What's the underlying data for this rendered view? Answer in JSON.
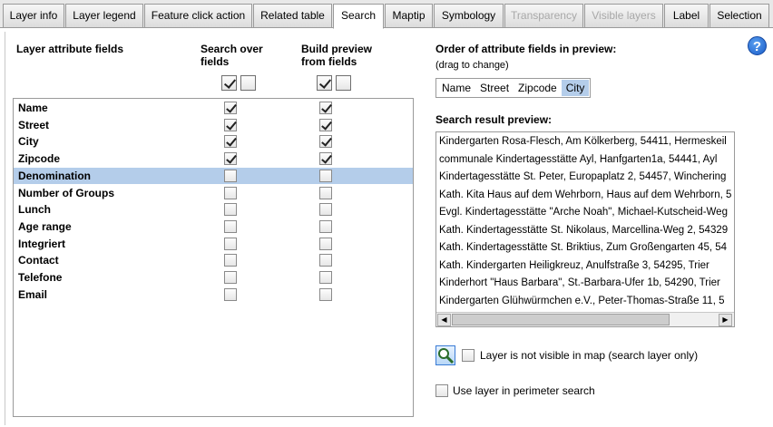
{
  "tabs": [
    {
      "label": "Layer info",
      "state": "normal"
    },
    {
      "label": "Layer legend",
      "state": "normal"
    },
    {
      "label": "Feature click action",
      "state": "normal"
    },
    {
      "label": "Related table",
      "state": "normal"
    },
    {
      "label": "Search",
      "state": "active"
    },
    {
      "label": "Maptip",
      "state": "normal"
    },
    {
      "label": "Symbology",
      "state": "normal"
    },
    {
      "label": "Transparency",
      "state": "disabled"
    },
    {
      "label": "Visible layers",
      "state": "disabled"
    },
    {
      "label": "Label",
      "state": "normal"
    },
    {
      "label": "Selection",
      "state": "normal"
    }
  ],
  "headers": {
    "layer_fields": "Layer attribute fields",
    "search_over_line1": "Search over",
    "search_over_line2": "fields",
    "build_preview_line1": "Build preview",
    "build_preview_line2": "from fields",
    "order_title": "Order of attribute fields in preview:",
    "order_hint": "(drag to change)",
    "preview_title": "Search result preview:"
  },
  "fields": [
    {
      "name": "Name",
      "search": true,
      "preview": true,
      "selected": false
    },
    {
      "name": "Street",
      "search": true,
      "preview": true,
      "selected": false
    },
    {
      "name": "City",
      "search": true,
      "preview": true,
      "selected": false
    },
    {
      "name": "Zipcode",
      "search": true,
      "preview": true,
      "selected": false
    },
    {
      "name": "Denomination",
      "search": false,
      "preview": false,
      "selected": true
    },
    {
      "name": "Number of Groups",
      "search": false,
      "preview": false,
      "selected": false
    },
    {
      "name": "Lunch",
      "search": false,
      "preview": false,
      "selected": false
    },
    {
      "name": "Age range",
      "search": false,
      "preview": false,
      "selected": false
    },
    {
      "name": "Integriert",
      "search": false,
      "preview": false,
      "selected": false
    },
    {
      "name": "Contact",
      "search": false,
      "preview": false,
      "selected": false
    },
    {
      "name": "Telefone",
      "search": false,
      "preview": false,
      "selected": false
    },
    {
      "name": "Email",
      "search": false,
      "preview": false,
      "selected": false
    }
  ],
  "order": [
    {
      "label": "Name",
      "highlighted": false
    },
    {
      "label": "Street",
      "highlighted": false
    },
    {
      "label": "Zipcode",
      "highlighted": false
    },
    {
      "label": "City",
      "highlighted": true
    }
  ],
  "preview_rows": [
    "Kindergarten Rosa-Flesch, Am Kölkerberg, 54411, Hermeskeil",
    "communale Kindertagesstätte Ayl, Hanfgarten1a, 54441, Ayl",
    "Kindertagesstätte St. Peter, Europaplatz 2, 54457, Winchering",
    "Kath. Kita Haus auf dem Wehrborn, Haus auf dem Wehrborn, 5",
    "Evgl. Kindertagesstätte \"Arche Noah\", Michael-Kutscheid-Weg",
    "Kath. Kindertagesstätte St. Nikolaus, Marcellina-Weg 2, 54329",
    "Kath. Kindertagesstätte St. Briktius, Zum Großengarten 45, 54",
    "Kath. Kindergarten Heiligkreuz, Anulfstraße 3, 54295, Trier",
    "Kinderhort \"Haus Barbara\", St.-Barbara-Ufer 1b, 54290, Trier",
    "Kindergarten Glühwürmchen e.V., Peter-Thomas-Straße 11, 5"
  ],
  "options": {
    "layer_not_visible": {
      "label": "Layer is not visible in map (search layer only)",
      "checked": false
    },
    "perimeter_search": {
      "label": "Use layer in perimeter search",
      "checked": false
    }
  },
  "help_label": "?",
  "scroll": {
    "left_arrow": "◀",
    "right_arrow": "▶"
  },
  "colors": {
    "selection": "#b4cdea",
    "help_blue": "#1a5cc8"
  }
}
